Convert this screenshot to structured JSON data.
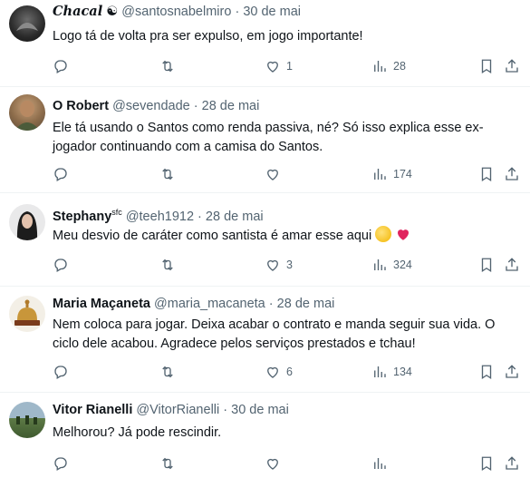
{
  "tweets": [
    {
      "name": "Chacal",
      "name_glyph": "☯",
      "handle": "@santosnabelmiro",
      "sep": "·",
      "date": "30 de mai",
      "text": "Logo tá de volta pra ser expulso, em jogo importante!",
      "likes": "1",
      "views": "28"
    },
    {
      "name": "O Robert",
      "handle": "@sevendade",
      "sep": "·",
      "date": "28 de mai",
      "text": "Ele tá usando o Santos como renda passiva, né? Só isso explica esse ex-jogador continuando com a camisa do Santos.",
      "likes": "",
      "views": "174"
    },
    {
      "name": "Stephany",
      "name_suffix": "sfc",
      "handle": "@teeh1912",
      "sep": "·",
      "date": "28 de mai",
      "text": "Meu desvio de caráter como santista é amar esse aqui",
      "likes": "3",
      "views": "324"
    },
    {
      "name": "Maria Maçaneta",
      "handle": "@maria_macaneta",
      "sep": "·",
      "date": "28 de mai",
      "text": "Nem coloca para jogar. Deixa acabar o contrato e manda seguir sua vida. O ciclo dele acabou. Agradece pelos serviços prestados e tchau!",
      "likes": "6",
      "views": "134"
    },
    {
      "name": "Vitor Rianelli",
      "handle": "@VitorRianelli",
      "sep": "·",
      "date": "30 de mai",
      "text": "Melhorou? Já pode rescindir.",
      "likes": "",
      "views": ""
    }
  ],
  "icons": {
    "reply": "reply-icon",
    "retweet": "retweet-icon",
    "like": "heart-icon",
    "views": "views-icon",
    "bookmark": "bookmark-icon",
    "share": "share-icon"
  },
  "colors": {
    "text": "#0f1419",
    "secondary": "#536471",
    "divider": "#eff3f4"
  }
}
